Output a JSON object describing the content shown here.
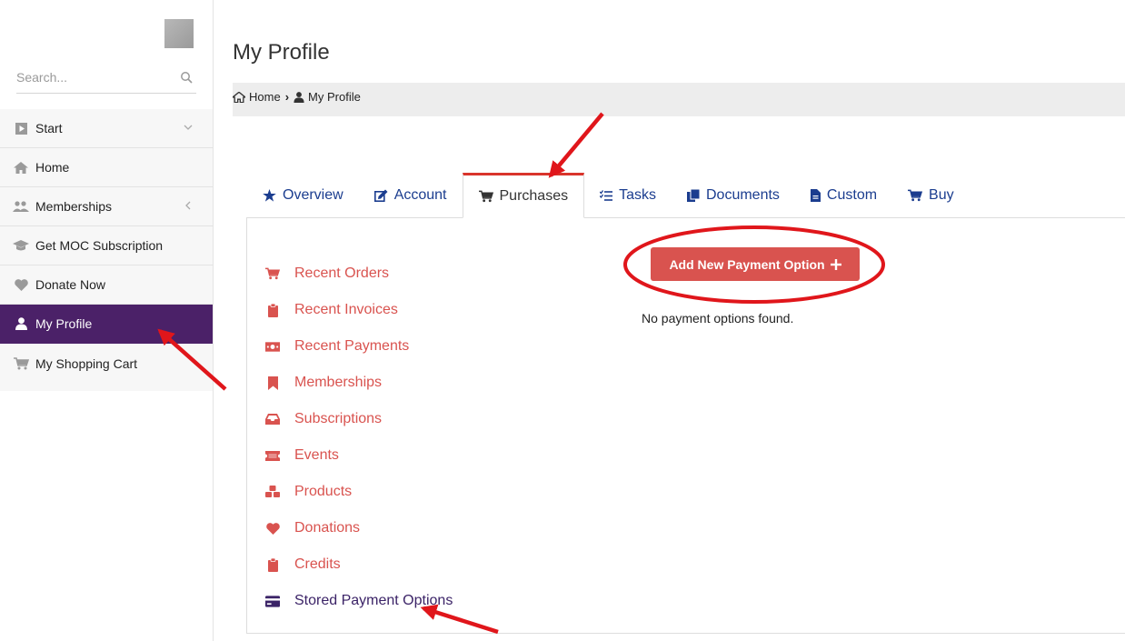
{
  "sidebar": {
    "search_placeholder": "Search...",
    "items": [
      {
        "label": "Start",
        "icon": "play-square-icon"
      },
      {
        "label": "Home",
        "icon": "home-icon"
      },
      {
        "label": "Memberships",
        "icon": "users-icon"
      },
      {
        "label": "Get MOC Subscription",
        "icon": "graduation-cap-icon"
      },
      {
        "label": "Donate Now",
        "icon": "heart-icon"
      },
      {
        "label": "My Profile",
        "icon": "user-icon",
        "active": true
      },
      {
        "label": "My Shopping Cart",
        "icon": "cart-icon"
      }
    ]
  },
  "page": {
    "title": "My Profile",
    "breadcrumb": {
      "home": "Home",
      "current": "My Profile"
    }
  },
  "tabs": [
    {
      "label": "Overview",
      "icon": "star-icon"
    },
    {
      "label": "Account",
      "icon": "edit-icon"
    },
    {
      "label": "Purchases",
      "icon": "cart-icon",
      "active": true
    },
    {
      "label": "Tasks",
      "icon": "tasks-icon"
    },
    {
      "label": "Documents",
      "icon": "documents-icon"
    },
    {
      "label": "Custom",
      "icon": "file-icon"
    },
    {
      "label": "Buy",
      "icon": "cart-icon"
    }
  ],
  "purchases_menu": [
    {
      "label": "Recent Orders",
      "icon": "cart-icon"
    },
    {
      "label": "Recent Invoices",
      "icon": "clipboard-icon"
    },
    {
      "label": "Recent Payments",
      "icon": "money-icon"
    },
    {
      "label": "Memberships",
      "icon": "bookmark-icon"
    },
    {
      "label": "Subscriptions",
      "icon": "inbox-icon"
    },
    {
      "label": "Events",
      "icon": "ticket-icon"
    },
    {
      "label": "Products",
      "icon": "cubes-icon"
    },
    {
      "label": "Donations",
      "icon": "heart-icon"
    },
    {
      "label": "Credits",
      "icon": "clipboard-icon"
    },
    {
      "label": "Stored Payment Options",
      "icon": "credit-card-icon",
      "current": true
    }
  ],
  "content": {
    "add_button_label": "Add New Payment Option",
    "empty_message": "No payment options found."
  },
  "colors": {
    "accent_purple": "#4b2168",
    "link_red": "#d9534f",
    "tab_blue": "#1b3d8f",
    "annotation_red": "#e0161b"
  }
}
